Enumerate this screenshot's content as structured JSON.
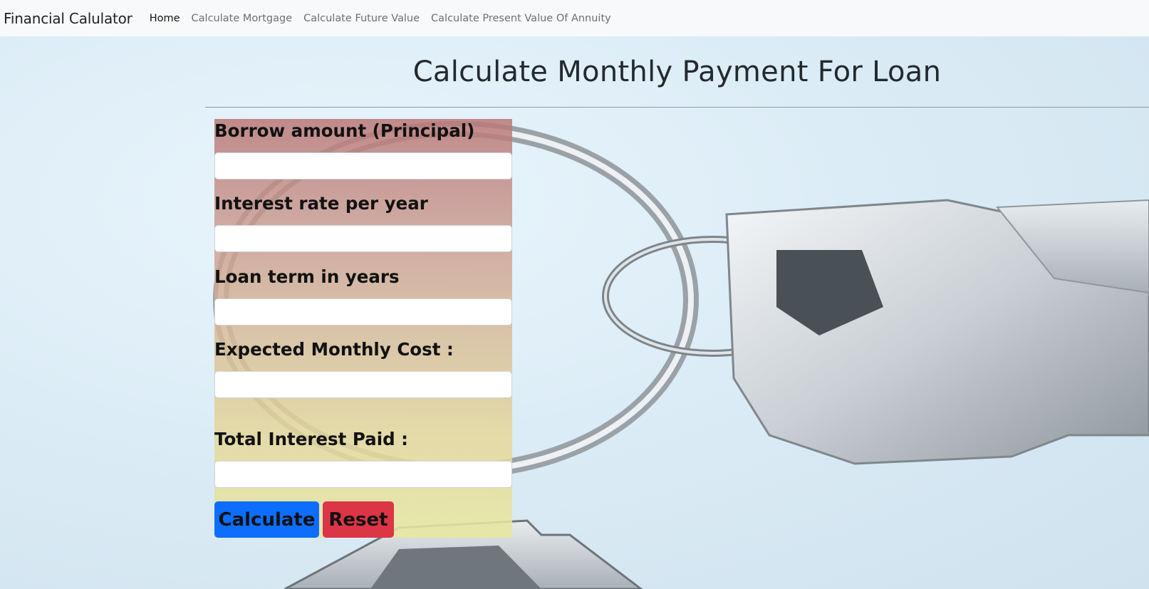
{
  "navbar": {
    "brand": "Financial Calulator",
    "links": [
      {
        "label": "Home",
        "active": true
      },
      {
        "label": "Calculate Mortgage",
        "active": false
      },
      {
        "label": "Calculate Future Value",
        "active": false
      },
      {
        "label": "Calculate Present Value Of Annuity",
        "active": false
      }
    ]
  },
  "main": {
    "title": "Calculate Monthly Payment For Loan"
  },
  "form": {
    "principal": {
      "label": "Borrow amount (Principal)",
      "value": "",
      "placeholder": ""
    },
    "rate": {
      "label": "Interest rate per year",
      "value": "",
      "placeholder": ""
    },
    "term": {
      "label": "Loan term in years",
      "value": "",
      "placeholder": ""
    },
    "monthly_cost": {
      "label": "Expected Monthly Cost :",
      "value": "",
      "placeholder": ""
    },
    "total_interest": {
      "label": "Total Interest Paid :",
      "value": "",
      "placeholder": ""
    },
    "calculate_label": "Calculate",
    "reset_label": "Reset"
  },
  "colors": {
    "calculate_button": "#0d6efd",
    "reset_button": "#dc3545",
    "navbar_bg": "#f8f9fa"
  }
}
